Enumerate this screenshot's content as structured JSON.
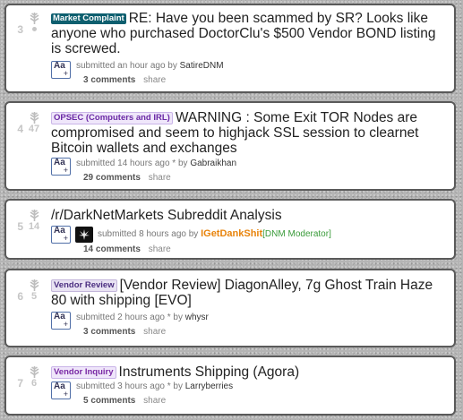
{
  "posts": [
    {
      "rank": "3",
      "score": "",
      "flair": "Market Complaint",
      "title": "RE: Have you been scammed by SR? Looks like anyone who purchased DoctorClu's $500 Vendor BOND listing is screwed.",
      "submitted": "submitted an hour ago by",
      "edited": "",
      "author": "SatireDNM",
      "comments": "3 comments",
      "share": "share"
    },
    {
      "rank": "4",
      "score": "47",
      "flair": "OPSEC (Computers and IRL)",
      "title": "WARNING : Some Exit TOR Nodes are compromised and seem to highjack SSL session to clearnet Bitcoin wallets and exchanges",
      "submitted": "submitted 14 hours ago",
      "edited": "* by",
      "author": "Gabraikhan",
      "comments": "29 comments",
      "share": "share"
    },
    {
      "rank": "5",
      "score": "14",
      "flair": "",
      "title": "/r/DarkNetMarkets Subreddit Analysis",
      "submitted": "submitted 8 hours ago by",
      "edited": "",
      "author": "IGetDankShit",
      "author_flair": "[DNM Moderator]",
      "comments": "14 comments",
      "share": "share"
    },
    {
      "rank": "6",
      "score": "5",
      "flair": "Vendor Review",
      "title": "[Vendor Review] DiagonAlley, 7g Ghost Train Haze 80 with shipping [EVO]",
      "submitted": "submitted 2 hours ago",
      "edited": "* by",
      "author": "whysr",
      "comments": "3 comments",
      "share": "share"
    },
    {
      "rank": "7",
      "score": "6",
      "flair": "Vendor Inquiry",
      "title": "Instruments Shipping (Agora)",
      "submitted": "submitted 3 hours ago",
      "edited": "* by",
      "author": "Larryberries",
      "comments": "5 comments",
      "share": "share"
    }
  ],
  "thumb": {
    "aa": "Aa",
    "plus": "+"
  },
  "colors": {
    "background": "#b4b4b4",
    "card_border": "#5a5a5a",
    "flair_market_complaint": "#0e5f6f",
    "moderator_name": "#e8840c",
    "moderator_flair": "#3a9b3a"
  },
  "icons": {
    "vote": "leaf-arrow-icon",
    "self_post_thumb": "text-post-icon",
    "subreddit_thumb": "cannabis-leaf-icon"
  }
}
